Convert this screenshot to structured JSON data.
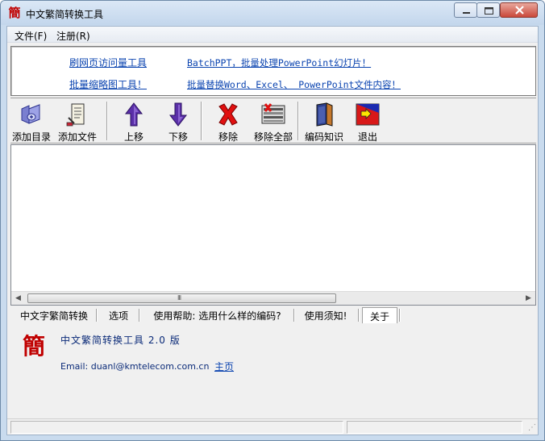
{
  "window": {
    "title": "中文繁简转换工具",
    "icon_char": "簡",
    "controls": [
      "minimize-icon",
      "maximize-icon",
      "close-icon"
    ]
  },
  "menu": [
    {
      "label": "文件(F)"
    },
    {
      "label": "注册(R)"
    }
  ],
  "banner": {
    "links": [
      {
        "text": "刷网页访问量工具"
      },
      {
        "text": "BatchPPT，批量处理PowerPoint幻灯片！"
      },
      {
        "text": "批量缩略图工具！"
      },
      {
        "text": "批量替换Word、Excel、 PowerPoint文件内容！"
      }
    ]
  },
  "toolbar": {
    "buttons": [
      {
        "label": "添加目录",
        "icon": "folder-add-icon"
      },
      {
        "label": "添加文件",
        "icon": "file-add-icon"
      },
      {
        "label": "上移",
        "icon": "arrow-up-icon"
      },
      {
        "label": "下移",
        "icon": "arrow-down-icon"
      },
      {
        "label": "移除",
        "icon": "red-x-icon"
      },
      {
        "label": "移除全部",
        "icon": "remove-all-icon"
      },
      {
        "label": "编码知识",
        "icon": "book-icon"
      },
      {
        "label": "退出",
        "icon": "exit-icon"
      }
    ]
  },
  "list": {
    "rows": [],
    "scroll_grip": "III"
  },
  "tabs": [
    {
      "label": "中文字繁简转换"
    },
    {
      "label": "选项"
    },
    {
      "label": "使用帮助: 选用什么样的编码?"
    },
    {
      "label": "使用须知!"
    },
    {
      "label": "关于",
      "active": true
    }
  ],
  "about": {
    "logo_char": "簡",
    "title": "中文繁简转换工具 2.0 版",
    "email": "Email: duanl@kmtelecom.com.cn",
    "home_link": "主页"
  },
  "statusbar": {
    "panels": [
      "",
      ""
    ]
  },
  "colors": {
    "link": "#0b44b0",
    "about_text": "#0a2a78",
    "logo_red": "#c00000"
  }
}
